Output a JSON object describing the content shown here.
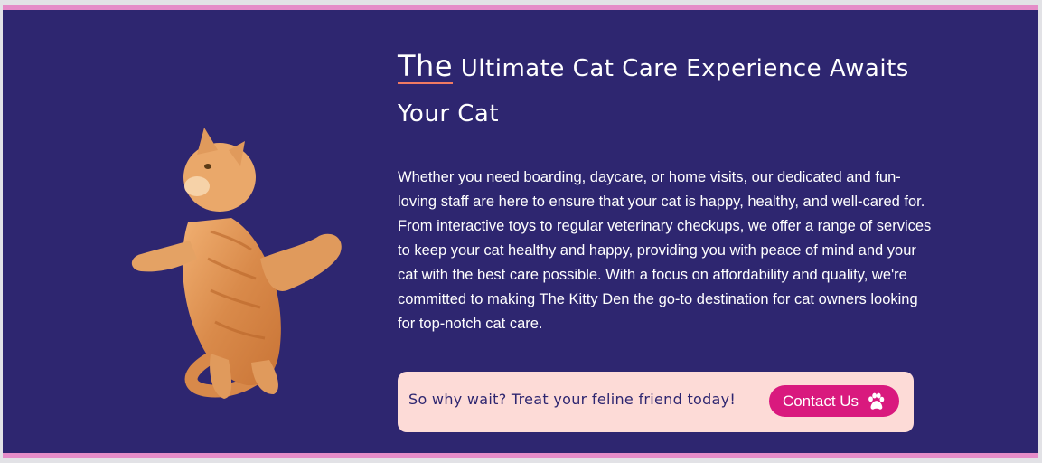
{
  "hero": {
    "title_first_word": "The",
    "title_rest": " Ultimate Cat Care Experience Awaits Your Cat",
    "description": "Whether you need boarding, daycare, or home visits, our dedicated and fun-loving staff are here to ensure that your cat is happy, healthy, and well-cared for. From interactive toys to regular veterinary checkups, we offer a range of services to keep your cat healthy and happy, providing you with peace of mind and your cat with the best care possible. With a focus on affordability and quality, we're committed to making The Kitty Den the go-to destination for cat owners looking for top-notch cat care."
  },
  "cta": {
    "text": "So why wait? Treat your feline friend today!",
    "button_label": "Contact Us",
    "button_icon": "paw-icon"
  },
  "colors": {
    "background": "#2e2670",
    "border": "#e58cc8",
    "accent_underline": "#f17b62",
    "cta_box": "#fddbd7",
    "button": "#d9197e"
  },
  "image": {
    "subject": "orange tabby cat"
  }
}
